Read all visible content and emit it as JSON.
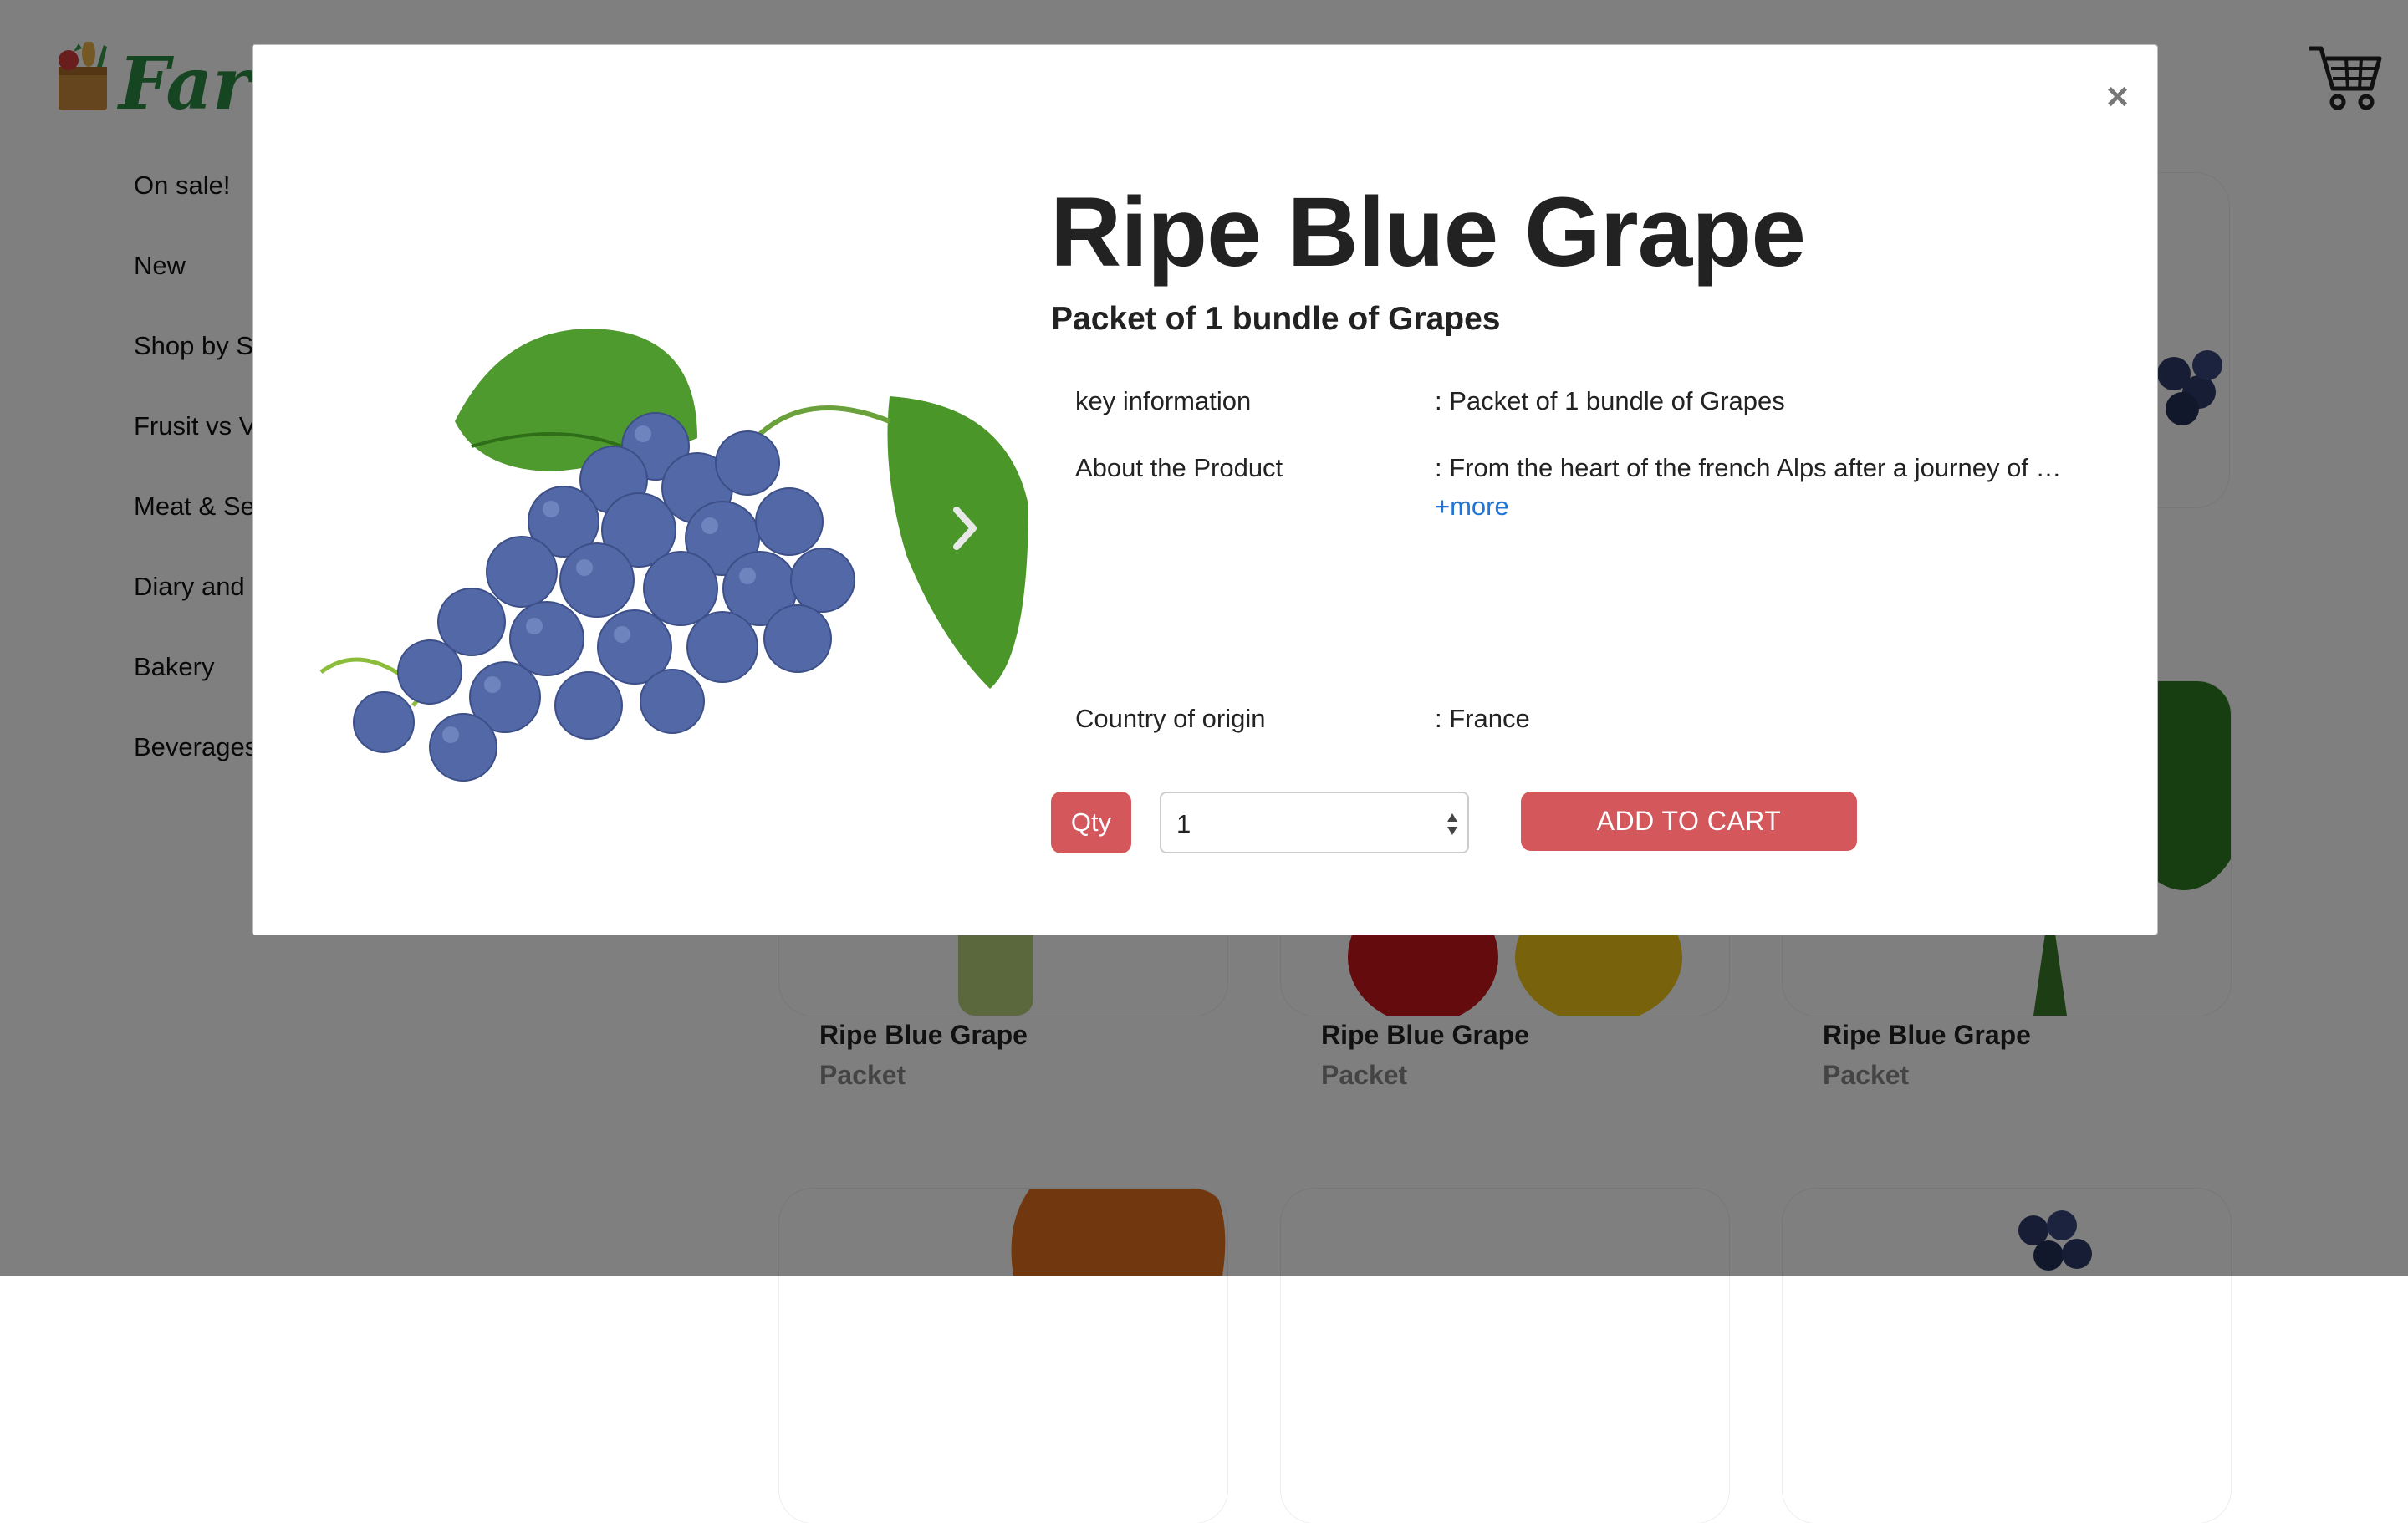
{
  "header": {
    "logo_text": "FarmF",
    "cart_icon": "shopping-cart-icon"
  },
  "sidebar": {
    "items": [
      {
        "label": "On sale!"
      },
      {
        "label": "New"
      },
      {
        "label": "Shop by S"
      },
      {
        "label": "Frusit vs V"
      },
      {
        "label": "Meat & Se"
      },
      {
        "label": "Diary and"
      },
      {
        "label": "Bakery"
      },
      {
        "label": "Beverages"
      }
    ]
  },
  "grid": {
    "cards": [
      {
        "title": "Ripe Blue Grape",
        "subtitle": "Packet"
      },
      {
        "title": "Ripe Blue Grape",
        "subtitle": "Packet"
      },
      {
        "title": "Ripe Blue Grape",
        "subtitle": "Packet"
      }
    ]
  },
  "modal": {
    "close_symbol": "×",
    "title": "Ripe Blue Grape",
    "subtitle": "Packet of 1 bundle of Grapes",
    "details": [
      {
        "label": "key information",
        "value": ": Packet of 1 bundle of Grapes"
      },
      {
        "label": "About the Product",
        "value": ": From the heart of the french Alps after a journey of …"
      },
      {
        "label": "Country of origin",
        "value": ": France"
      }
    ],
    "more_link": "+more",
    "qty_label": "Qty",
    "qty_value": "1",
    "add_to_cart": "ADD TO CART",
    "next_icon": "chevron-right-icon"
  },
  "colors": {
    "accent": "#d4575b",
    "link": "#1f76d6",
    "logo_green": "#2c8a45",
    "overlay": "rgba(0,0,0,0.5)"
  }
}
